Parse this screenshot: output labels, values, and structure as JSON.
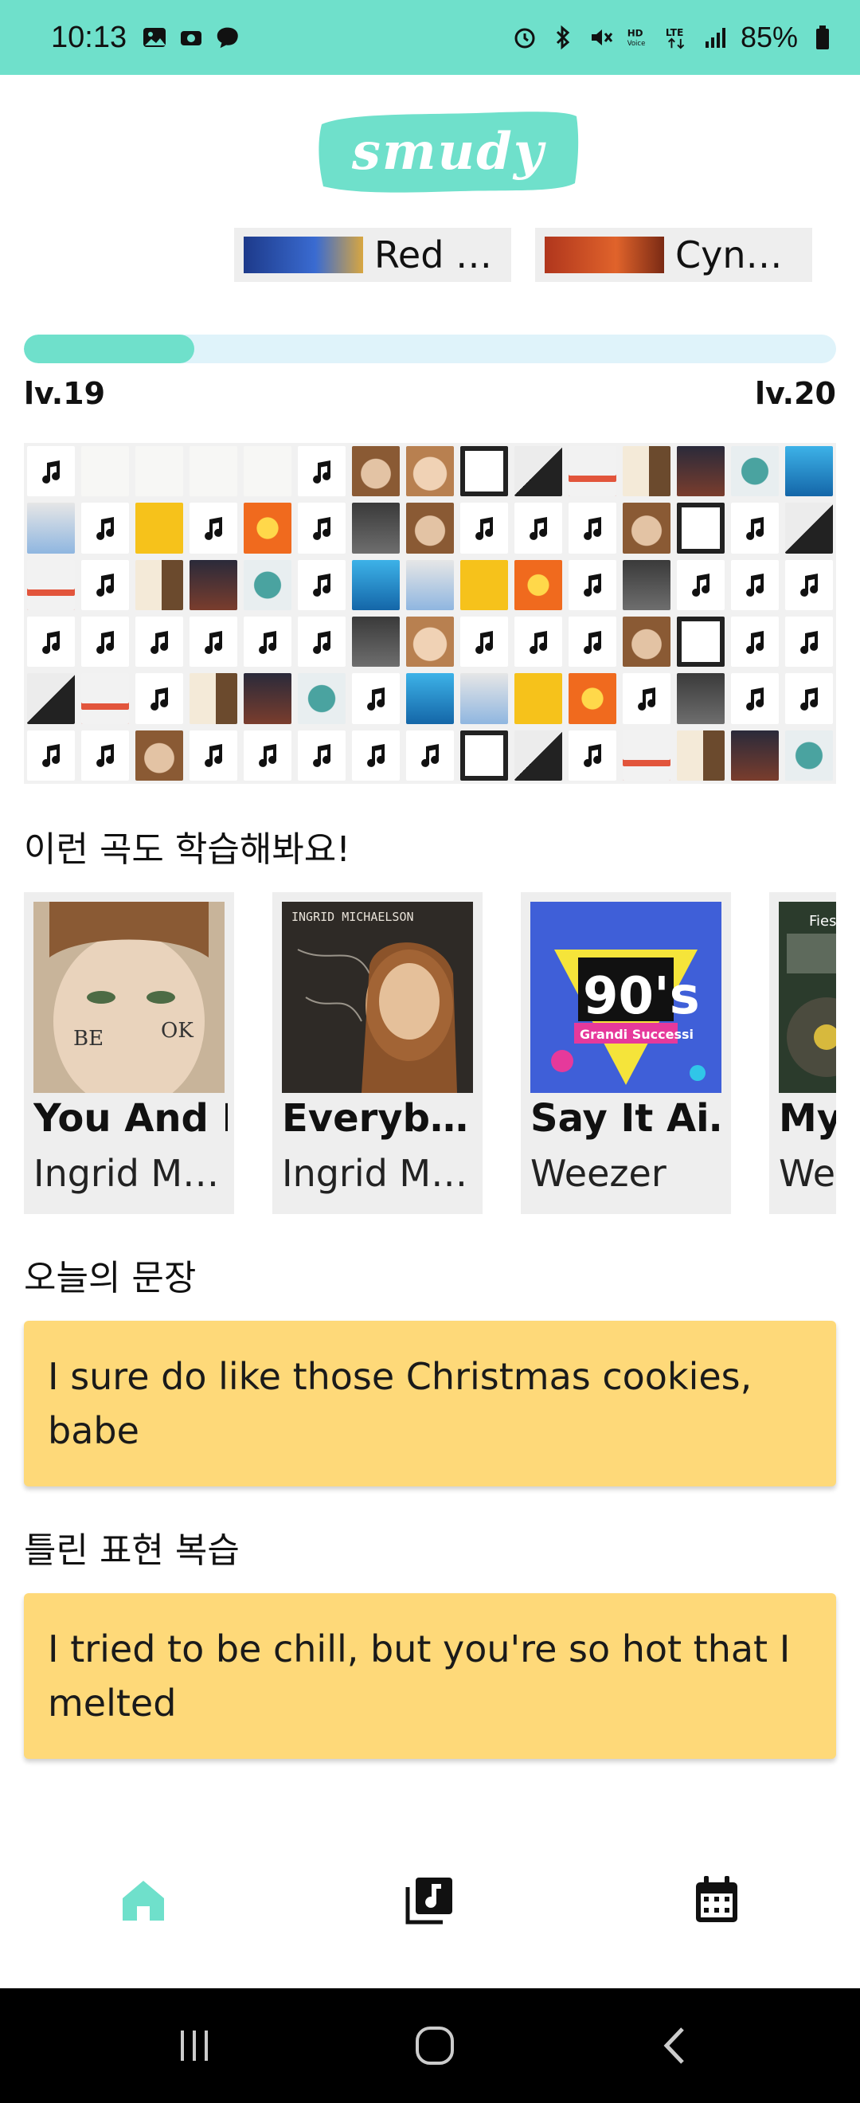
{
  "status_bar": {
    "time": "10:13",
    "battery": "85%",
    "left_icons": [
      "gallery-icon",
      "sync-icon",
      "messenger-icon"
    ],
    "right_icons": [
      "alarm-icon",
      "bluetooth-icon",
      "mute-icon",
      "hd-voice-icon",
      "lte-icon",
      "signal-icon",
      "battery-icon"
    ]
  },
  "header": {
    "logo_text": "smudy",
    "accent": "#6fe0cb"
  },
  "top_cards": [
    {
      "title": "Red …"
    },
    {
      "title": "Cyn…"
    }
  ],
  "progress": {
    "fraction": 0.21,
    "current_level": "lv.19",
    "next_level": "lv.20"
  },
  "mosaic": {
    "rows": [
      [
        "note",
        "white",
        "white",
        "white",
        "white",
        "note",
        "face",
        "face2",
        "bw",
        "tag",
        "love",
        "art",
        "dark",
        "globe",
        "blue"
      ],
      [
        "grey",
        "note",
        "okb",
        "note",
        "oog",
        "note",
        "rock",
        "face",
        "note",
        "note",
        "note",
        "face",
        "bw",
        "note",
        "tag"
      ],
      [
        "love",
        "note",
        "art",
        "dark",
        "globe",
        "note",
        "blue",
        "grey",
        "okb",
        "oog",
        "note",
        "rock",
        "note",
        "note",
        "note"
      ],
      [
        "note",
        "note",
        "note",
        "note",
        "note",
        "note",
        "rock",
        "face2",
        "note",
        "note",
        "note",
        "face",
        "bw",
        "note",
        "note"
      ],
      [
        "tag",
        "love",
        "note",
        "art",
        "dark",
        "globe",
        "note",
        "blue",
        "grey",
        "okb",
        "oog",
        "note",
        "rock",
        "note",
        "note"
      ],
      [
        "note",
        "note",
        "face",
        "note",
        "note",
        "note",
        "note",
        "note",
        "bw",
        "tag",
        "note",
        "love",
        "art",
        "dark",
        "globe"
      ]
    ]
  },
  "recommend": {
    "heading": "이런 곡도 학습해봐요!",
    "cards": [
      {
        "title": "You And I",
        "artist": "Ingrid M…",
        "art_text": "BE   OK"
      },
      {
        "title": "Everyb…",
        "artist": "Ingrid M…",
        "art_text": "INGRID MICHAELSON"
      },
      {
        "title": "Say It Ai…",
        "artist": "Weezer",
        "art_text": "90's"
      },
      {
        "title": "My",
        "artist": "We",
        "art_text": "Fies"
      }
    ]
  },
  "today_sentence": {
    "heading": "오늘의 문장",
    "text": "I sure do like those Christmas cookies, babe"
  },
  "review": {
    "heading": "틀린 표현 복습",
    "text": "I tried to be chill, but you're so hot that I melted"
  },
  "bottom_nav": {
    "items": [
      "home-icon",
      "music-library-icon",
      "calendar-icon"
    ],
    "active_color": "#6fe0cb"
  },
  "system_nav": [
    "recent-apps-button",
    "home-button",
    "back-button"
  ]
}
